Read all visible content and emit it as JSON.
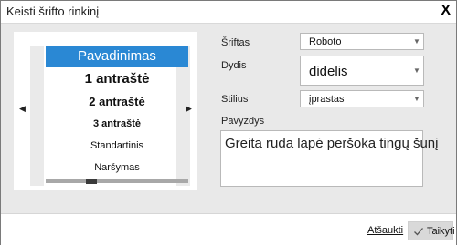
{
  "dialog": {
    "title": "Keisti šrifto rinkinį",
    "close_label": "X"
  },
  "style_list": {
    "items": [
      "Pavadinimas",
      "1 antraštė",
      "2 antraštė",
      "3 antraštė",
      "Standartinis",
      "Naršymas"
    ],
    "selected_index": 0,
    "left_arrow": "◀",
    "right_arrow": "▶"
  },
  "form": {
    "font_label": "Šriftas",
    "font_value": "Roboto",
    "size_label": "Dydis",
    "size_value": "didelis",
    "style_label": "Stilius",
    "style_value": "įprastas",
    "example_label": "Pavyzdys",
    "example_text": "Greita ruda lapė peršoka tingų šunį"
  },
  "footer": {
    "cancel_label": "Atšaukti",
    "apply_label": "Taikyti"
  },
  "colors": {
    "accent": "#2a88d4",
    "body_bg": "#e9e9e9"
  }
}
